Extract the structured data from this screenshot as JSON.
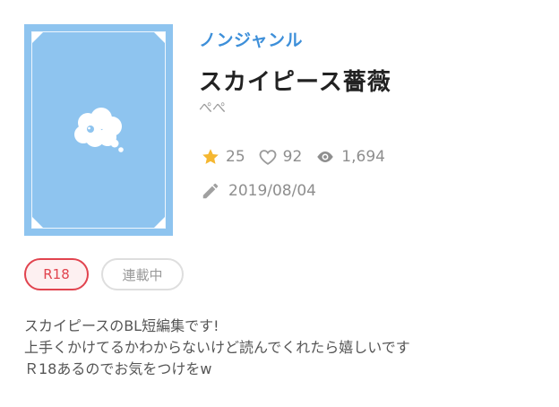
{
  "cover": {
    "color": "#8ec4ef",
    "icon": "thought-cloud-icon"
  },
  "work": {
    "genre": "ノンジャンル",
    "title": "スカイピース薔薇",
    "author": "ぺぺ"
  },
  "stats": {
    "stars": "25",
    "likes": "92",
    "views": "1,694",
    "date": "2019/08/04"
  },
  "tags": {
    "rating": "R18",
    "status": "連載中"
  },
  "description": {
    "line1": "スカイピースのBL短編集です!",
    "line2": "上手くかけてるかわからないけど読んでくれたら嬉しいです",
    "line3": "Ｒ18あるのでお気をつけをw"
  },
  "colors": {
    "genre": "#3d8fd9",
    "star": "#f5b731",
    "r18": "#e1434e",
    "muted": "#8e8e8e"
  }
}
